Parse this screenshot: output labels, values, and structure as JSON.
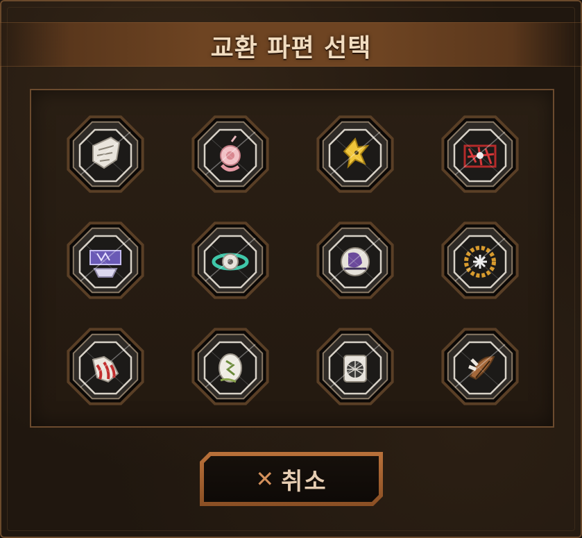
{
  "dialog": {
    "title": "교환 파편 선택",
    "cancel_label": "취소",
    "cancel_icon": "x-icon"
  },
  "colors": {
    "panel_border": "#6c4b2e",
    "title_band": "#6e4422",
    "title_text": "#f1dcc0",
    "button_border": "#b9713a",
    "button_icon": "#d3905b"
  },
  "pieces": [
    {
      "icon": "white-wing-emblem"
    },
    {
      "icon": "pink-flower-emblem"
    },
    {
      "icon": "yellow-bird-emblem"
    },
    {
      "icon": "red-thorn-emblem"
    },
    {
      "icon": "purple-chain-emblem"
    },
    {
      "icon": "teal-orbit-emblem"
    },
    {
      "icon": "purple-moon-emblem"
    },
    {
      "icon": "gold-wreath-emblem"
    },
    {
      "icon": "red-claw-emblem"
    },
    {
      "icon": "cracked-egg-emblem"
    },
    {
      "icon": "white-net-emblem"
    },
    {
      "icon": "brown-feather-emblem"
    }
  ]
}
